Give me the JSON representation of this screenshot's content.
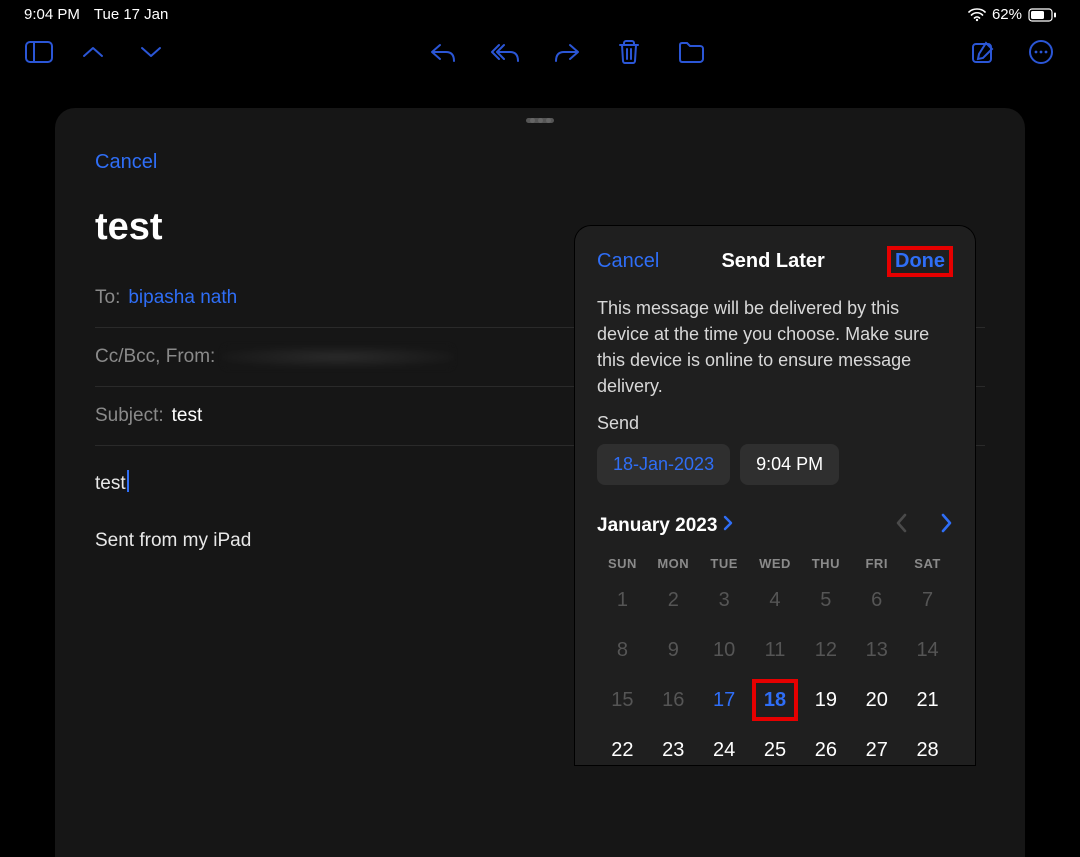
{
  "status": {
    "time": "9:04 PM",
    "date": "Tue 17 Jan",
    "battery": "62%"
  },
  "compose": {
    "cancel": "Cancel",
    "title": "test",
    "to_label": "To:",
    "to_value": "bipasha nath",
    "cc_label": "Cc/Bcc, From:",
    "subject_label": "Subject:",
    "subject_value": "test",
    "body": "test",
    "signature": "Sent from my iPad"
  },
  "sendlater": {
    "cancel": "Cancel",
    "title": "Send Later",
    "done": "Done",
    "desc": "This message will be delivered by this device at the time you choose. Make sure this device is online to ensure message delivery.",
    "send_label": "Send",
    "date_chip": "18-Jan-2023",
    "time_chip": "9:04 PM",
    "month": "January 2023",
    "dow": [
      "SUN",
      "MON",
      "TUE",
      "WED",
      "THU",
      "FRI",
      "SAT"
    ],
    "weeks": [
      [
        {
          "d": "1",
          "dim": true
        },
        {
          "d": "2",
          "dim": true
        },
        {
          "d": "3",
          "dim": true
        },
        {
          "d": "4",
          "dim": true
        },
        {
          "d": "5",
          "dim": true
        },
        {
          "d": "6",
          "dim": true
        },
        {
          "d": "7",
          "dim": true
        }
      ],
      [
        {
          "d": "8",
          "dim": true
        },
        {
          "d": "9",
          "dim": true
        },
        {
          "d": "10",
          "dim": true
        },
        {
          "d": "11",
          "dim": true
        },
        {
          "d": "12",
          "dim": true
        },
        {
          "d": "13",
          "dim": true
        },
        {
          "d": "14",
          "dim": true
        }
      ],
      [
        {
          "d": "15",
          "dim": true
        },
        {
          "d": "16",
          "dim": true
        },
        {
          "d": "17",
          "today": true
        },
        {
          "d": "18",
          "sel": true
        },
        {
          "d": "19"
        },
        {
          "d": "20"
        },
        {
          "d": "21"
        }
      ],
      [
        {
          "d": "22"
        },
        {
          "d": "23"
        },
        {
          "d": "24"
        },
        {
          "d": "25"
        },
        {
          "d": "26"
        },
        {
          "d": "27"
        },
        {
          "d": "28"
        }
      ]
    ]
  }
}
